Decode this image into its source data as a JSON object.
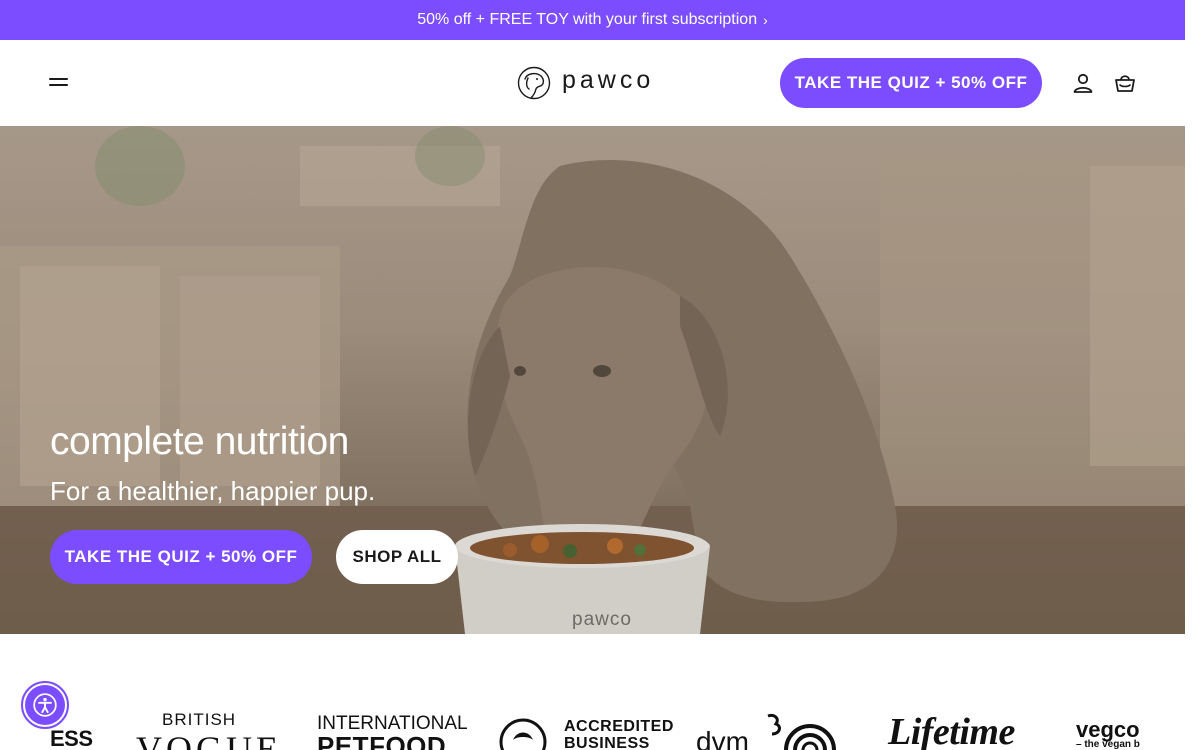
{
  "announcement": {
    "text": "50% off + FREE TOY with your first subscription",
    "chevron": "›"
  },
  "header": {
    "menu_icon": "hamburger-menu-icon",
    "logo_text": "pawco",
    "quiz_button": "TAKE THE QUIZ + 50% OFF",
    "account_icon": "user-account-icon",
    "cart_icon": "basket-cart-icon"
  },
  "hero": {
    "title": "complete nutrition",
    "subtitle": "For a healthier, happier pup.",
    "quiz_button": "TAKE THE QUIZ + 50% OFF",
    "shop_button": "SHOP ALL",
    "bowl_brand": "pawco"
  },
  "press": {
    "logo_1": "ESS",
    "logo_2_top": "BRITISH",
    "logo_2_main": "VOGUE",
    "logo_3_top": "INTERNATIONAL",
    "logo_3_main": "PETFOOD",
    "logo_4_line1": "ACCREDITED",
    "logo_4_line2": "BUSINESS",
    "logo_5": "dvm",
    "logo_6": "Lifetime",
    "logo_7": "vegco",
    "logo_7_sub": "– the vegan b"
  },
  "colors": {
    "brand_purple": "#7c4dff",
    "white": "#ffffff",
    "text_dark": "#1a1a1a"
  },
  "accessibility": {
    "icon": "accessibility-person-icon"
  }
}
